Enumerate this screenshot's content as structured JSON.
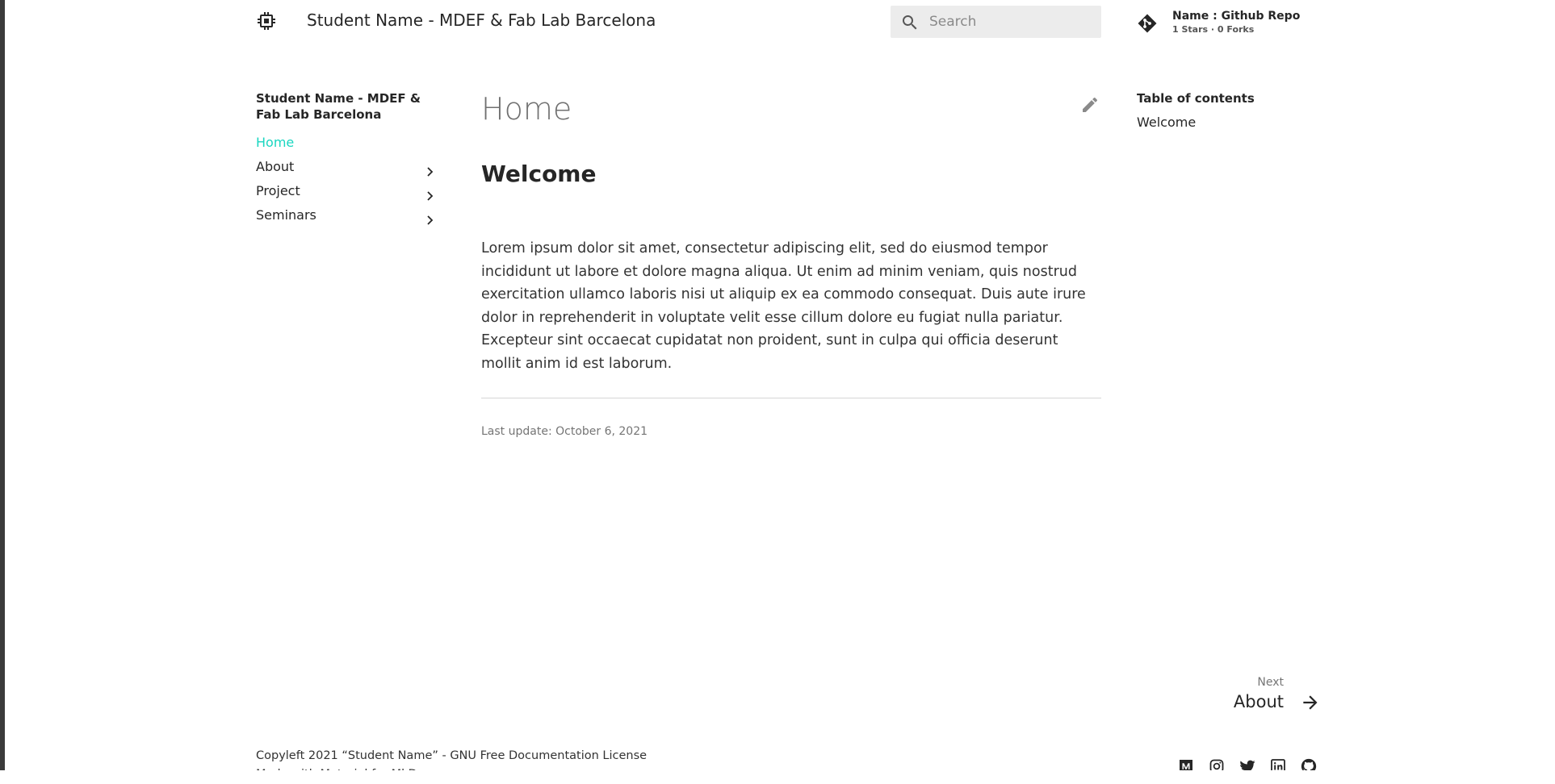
{
  "header": {
    "logo_icon": "cpu-chip-icon",
    "site_title": "Student Name - MDEF & Fab Lab Barcelona",
    "search": {
      "placeholder": "Search",
      "value": "",
      "icon": "search-icon"
    },
    "repo": {
      "icon": "git-icon",
      "name": "Name : Github Repo",
      "facts": "1 Stars · 0 Forks"
    }
  },
  "sidebar": {
    "title": "Student Name - MDEF & Fab Lab Barcelona",
    "items": [
      {
        "label": "Home",
        "active": true,
        "expandable": false
      },
      {
        "label": "About",
        "active": false,
        "expandable": true
      },
      {
        "label": "Project",
        "active": false,
        "expandable": true
      },
      {
        "label": "Seminars",
        "active": false,
        "expandable": true
      }
    ]
  },
  "main": {
    "title": "Home",
    "edit_icon": "pencil-icon",
    "heading": "Welcome",
    "paragraph": "Lorem ipsum dolor sit amet, consectetur adipiscing elit, sed do eiusmod tempor incididunt ut labore et dolore magna aliqua. Ut enim ad minim veniam, quis nostrud exercitation ullamco laboris nisi ut aliquip ex ea commodo consequat. Duis aute irure dolor in reprehenderit in voluptate velit esse cillum dolore eu fugiat nulla pariatur. Excepteur sint occaecat cupidatat non proident, sunt in culpa qui officia deserunt mollit anim id est laborum.",
    "last_update": "Last update: October 6, 2021"
  },
  "toc": {
    "title": "Table of contents",
    "items": [
      {
        "label": "Welcome"
      }
    ]
  },
  "next": {
    "caption": "Next",
    "title": "About",
    "icon": "arrow-right-icon"
  },
  "footer": {
    "copyright": "Copyleft 2021 “Student Name” - GNU Free Documentation License",
    "made_with": "Made with Material for MkDocs",
    "social_icons": [
      "medium-icon",
      "instagram-icon",
      "twitter-icon",
      "linkedin-icon",
      "github-icon"
    ]
  },
  "colors": {
    "accent": "#1ad6c0",
    "text": "#262626",
    "search_bg": "#ececec"
  }
}
